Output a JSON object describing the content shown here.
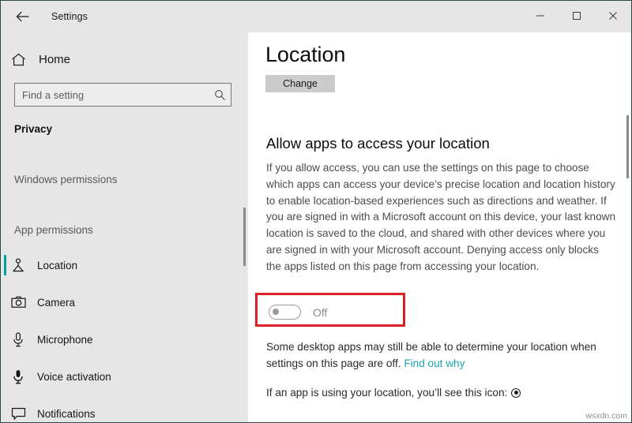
{
  "window": {
    "titlebar_title": "Settings",
    "back_icon": "back-arrow-icon",
    "minimize_label": "–",
    "maximize_label": "☐",
    "close_label": "✕",
    "accent_color": "#00a0a8",
    "highlight_color": "#dd1f26",
    "titlebar_bg": "#e6e6e6",
    "sidebar_bg": "#e6e6e6",
    "content_bg": "#ffffff"
  },
  "sidebar": {
    "home_label": "Home",
    "home_icon": "home-icon",
    "search": {
      "placeholder": "Find a setting",
      "value": "",
      "icon": "search-icon"
    },
    "category_header": "Privacy",
    "groups": [
      {
        "label": "Windows permissions",
        "items": []
      },
      {
        "label": "App permissions",
        "items": [
          {
            "label": "Location",
            "icon": "location-pin-icon",
            "selected": true
          },
          {
            "label": "Camera",
            "icon": "camera-icon",
            "selected": false
          },
          {
            "label": "Microphone",
            "icon": "microphone-icon",
            "selected": false
          },
          {
            "label": "Voice activation",
            "icon": "voice-activation-icon",
            "selected": false
          },
          {
            "label": "Notifications",
            "icon": "notification-icon",
            "selected": false
          }
        ]
      }
    ]
  },
  "main": {
    "page_title": "Location",
    "change_button_label": "Change",
    "section_title": "Allow apps to access your location",
    "body_paragraph": "If you allow access, you can use the settings on this page to choose which apps can access your device’s precise location and location history to enable location-based experiences such as directions and weather. If you are signed in with a Microsoft account on this device, your last known location is saved to the cloud, and shared with other devices where you are signed in with your Microsoft account. Denying access only blocks the apps listed on this page from accessing your location.",
    "toggle": {
      "state_label": "Off",
      "checked": false
    },
    "desktop_note_text": "Some desktop apps may still be able to determine your location when settings on this page are off. ",
    "desktop_note_link": "Find out why",
    "icon_note_text": "If an app is using your location, you’ll see this icon:",
    "icon_note_icon": "location-active-indicator-icon"
  },
  "watermark": "wsxdn.com"
}
